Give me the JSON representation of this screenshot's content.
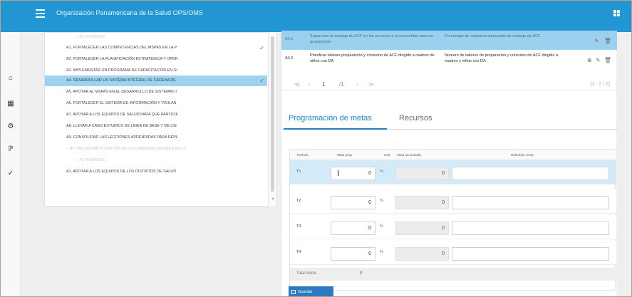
{
  "header": {
    "title": "Organización Panamericana de la Salud OPS/OMS",
    "menu_icon": "menu-icon",
    "apps_icon": "grid-icon"
  },
  "sidebar": {
    "items": [
      {
        "icon": "home-icon",
        "glyph": "⌂"
      },
      {
        "icon": "grid-icon",
        "glyph": "▦"
      },
      {
        "icon": "gear-icon",
        "glyph": "⚙"
      },
      {
        "icon": "chart-icon",
        "glyph": "ℙ"
      },
      {
        "icon": "check-icon",
        "glyph": "✓"
      }
    ]
  },
  "tree": {
    "rows": [
      {
        "label": "– ACTIVIDADES",
        "muted": true
      },
      {
        "label": "A1. FORTALECER LAS COMPETENCIAS DEL MSPAS EN LA P",
        "checked": true
      },
      {
        "label": "A2. FORTALECER LA PLANIFICACIÓN ESTRATÉGICA Y OPER"
      },
      {
        "label": "A3. IMPLEMENTAR UN PROGRAMA DE CAPACITACIÓN EN SI"
      },
      {
        "label": "A4. DESARROLLAR UN SISTEMA INTEGRAL DE CADENA DE",
        "selected": true,
        "checked": true
      },
      {
        "label": "A5. APOYAR AL MSPAS EN EL DESARROLLO DE SISTEMAS I"
      },
      {
        "label": "A6. FORTALECER EL SISTEMA DE INFORMACIÓN Y VIGILAN"
      },
      {
        "label": "A7. APOYAR A LOS EQUIPOS DE SALUD PARA QUE PARTICIF"
      },
      {
        "label": "A8. LLEVAR A CABO ESTUDIOS DE LÍNEA DE BASE Y DE LÍN"
      },
      {
        "label": "A9. CONSOLIDAR LAS LECCIONES APRENDIDAS PARA REPL"
      },
      {
        "label": "– R2. MAYOR PARTICIPACIÓN DE LA COMUNIDAD BASADA EN LO",
        "muted": true
      },
      {
        "label": "– ACTIVIDADES",
        "muted": true
      },
      {
        "label": "A1. APOYAR A LOS EQUIPOS DE LOS DISTRITOS DE SALUD"
      }
    ]
  },
  "activities": {
    "rows": [
      {
        "code": "A4.1",
        "description": "Supervisar la entrega de ACF en los servicios y la comunidad para su preparación",
        "indicator": "Porcentaje de cobertura adecuada de entrega de ACF",
        "selected": true
      },
      {
        "code": "A4.2",
        "description": "Planificar talleres preparación y consumo de ACF dirigido a madres de niños con DA",
        "indicator": "Número de talleres de preparación y consumo de ACF dirigido a madres y niños con DA",
        "selected": false
      }
    ],
    "pager": {
      "first": "≪",
      "prev": "‹",
      "page": "1",
      "total": "/1",
      "next": "›",
      "last": "≫",
      "count": "[1 - 2 / 2]"
    }
  },
  "tabs": [
    {
      "label": "Programación de metas",
      "active": true
    },
    {
      "label": "Recursos",
      "active": false
    }
  ],
  "metas": {
    "headers": {
      "periodo": "Periodo",
      "meta_prog": "Meta prog.",
      "um": "U/M",
      "meta_acum": "Meta acumulada",
      "definicion": "Definición meta"
    },
    "rows": [
      {
        "periodo": "T1",
        "meta": "0",
        "unit": "%",
        "acum": "0",
        "definicion": "",
        "selected": true
      },
      {
        "periodo": "T2",
        "meta": "0",
        "unit": "%",
        "acum": "0",
        "definicion": ""
      },
      {
        "periodo": "T3",
        "meta": "0",
        "unit": "%",
        "acum": "0",
        "definicion": ""
      },
      {
        "periodo": "T4",
        "meta": "0",
        "unit": "%",
        "acum": "0",
        "definicion": ""
      }
    ],
    "total_label": "Total meta",
    "total_value": "0"
  },
  "actions": {
    "save_label": "Guardar"
  }
}
